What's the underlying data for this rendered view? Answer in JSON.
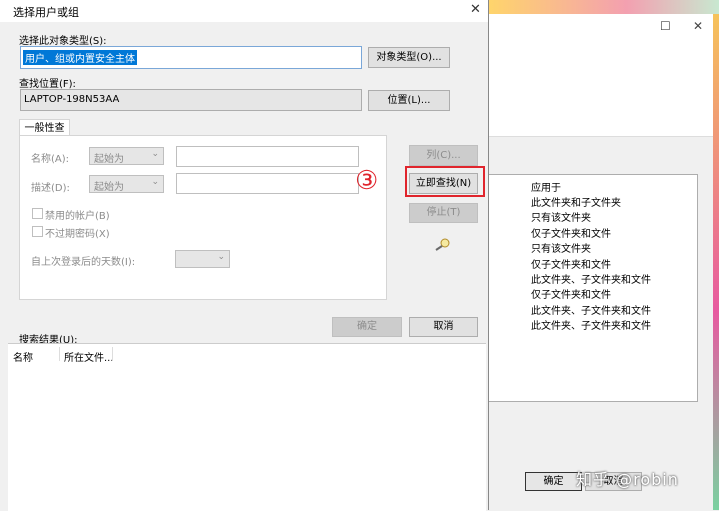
{
  "dialog": {
    "title": "选择用户或组",
    "object_type_label": "选择此对象类型(S):",
    "object_type_value": "用户、组或内置安全主体",
    "object_type_button": "对象类型(O)...",
    "location_label": "查找位置(F):",
    "location_value": "LAPTOP-198N53AA",
    "location_button": "位置(L)...",
    "tab_label": "一般性查询",
    "name_label": "名称(A):",
    "name_combo": "起始为",
    "desc_label": "描述(D):",
    "desc_combo": "起始为",
    "disabled_accounts_label": "禁用的帐户(B)",
    "no_expire_label": "不过期密码(X)",
    "days_since_login_label": "自上次登录后的天数(I):",
    "columns_button": "列(C)...",
    "find_now_button": "立即查找(N)",
    "stop_button": "停止(T)",
    "ok_button": "确定",
    "cancel_button": "取消",
    "results_label": "搜索结果(U):",
    "results_columns": [
      "名称",
      "所在文件..."
    ]
  },
  "annotation": {
    "step_marker": "③",
    "highlight_color": "#e0242c"
  },
  "background_window": {
    "apply_to_items": [
      "应用于",
      "此文件夹和子文件夹",
      "只有该文件夹",
      "仅子文件夹和文件",
      "只有该文件夹",
      "仅子文件夹和文件",
      "此文件夹、子文件夹和文件",
      "仅子文件夹和文件",
      "此文件夹、子文件夹和文件",
      "此文件夹、子文件夹和文件"
    ],
    "ok_button": "确定",
    "cancel_button": "取消",
    "watermark": "知乎 @robin"
  },
  "colors": {
    "selection": "#0078d7",
    "dialog_bg": "#f0f0f0"
  }
}
